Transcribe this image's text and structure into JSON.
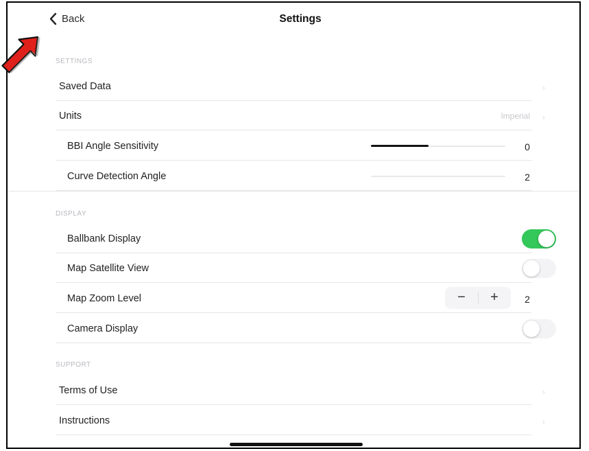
{
  "nav": {
    "back_label": "Back",
    "title": "Settings"
  },
  "sections": {
    "settings": "SETTINGS",
    "display": "DISPLAY",
    "support": "SUPPORT"
  },
  "settings": {
    "saved_data": "Saved Data",
    "units_label": "Units",
    "units_value": "Imperial",
    "bbi_label": "BBI Angle Sensitivity",
    "bbi_value": "0",
    "bbi_level": 0.43,
    "curve_label": "Curve Detection Angle",
    "curve_value": "2",
    "curve_level": 0.0
  },
  "display": {
    "ballbank_label": "Ballbank Display",
    "ballbank_on": true,
    "satellite_label": "Map Satellite View",
    "satellite_on": false,
    "zoom_label": "Map Zoom Level",
    "zoom_minus": "−",
    "zoom_plus": "+",
    "zoom_value": "2",
    "camera_label": "Camera Display",
    "camera_on": false
  },
  "support": {
    "terms": "Terms of Use",
    "instructions": "Instructions"
  },
  "icons": {
    "back": "chevron-left-icon",
    "disclosure": "chevron-right-icon",
    "annotation": "red-arrow-icon"
  },
  "colors": {
    "toggle_on": "#34c759",
    "annotation_arrow": "#e0201a",
    "separator": "#e6e6ea"
  }
}
